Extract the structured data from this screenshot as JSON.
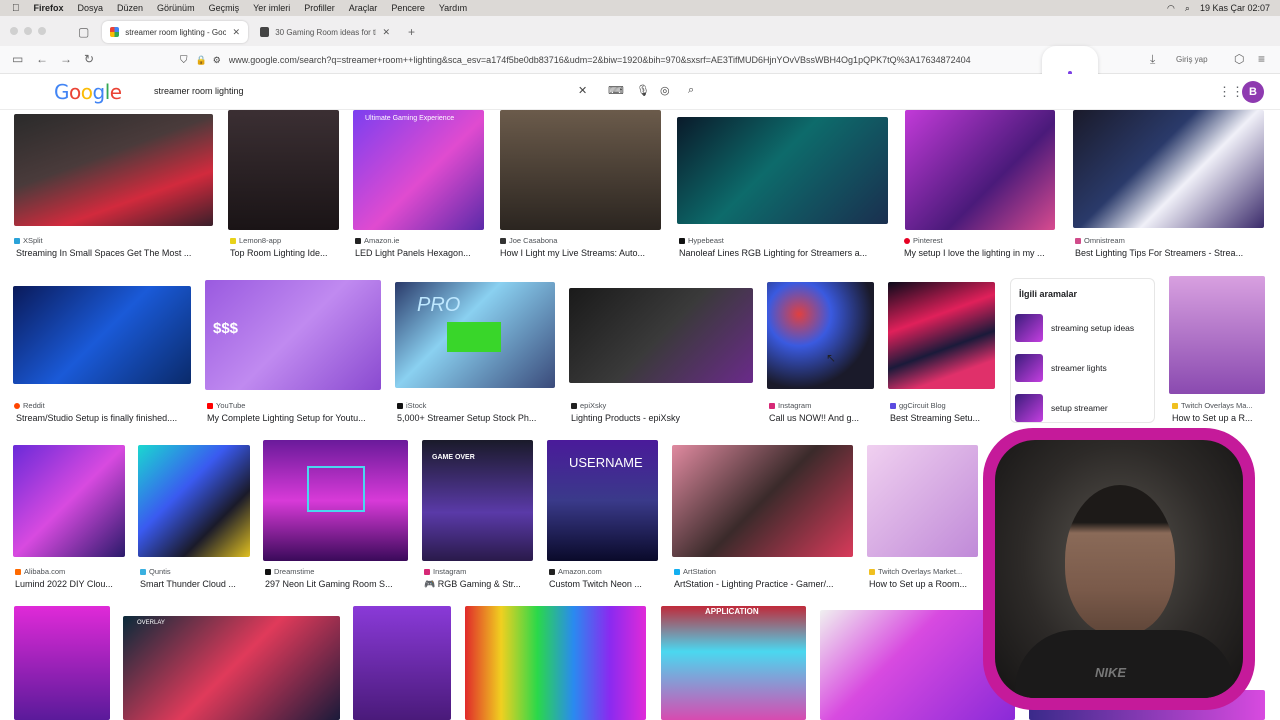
{
  "menubar": {
    "items": [
      "Firefox",
      "Dosya",
      "Düzen",
      "Görünüm",
      "Geçmiş",
      "Yer imleri",
      "Profiller",
      "Araçlar",
      "Pencere",
      "Yardım"
    ],
    "clock": "19 Kas Çar 02:07"
  },
  "tabs": [
    {
      "label": "streamer room lighting - Google",
      "active": true
    },
    {
      "label": "30 Gaming Room ideas for the B",
      "active": false
    }
  ],
  "navbar": {
    "url": "www.google.com/search?q=streamer+room++lighting&sca_esv=a174f5be0db83716&udm=2&biw=1920&bih=970&sxsrf=AE3TifMUD6HjnYOvVBssWBH4Og1pQPK7tQ%3A17634872404",
    "login": "Giriş yap"
  },
  "google": {
    "logo": "Google",
    "query": "streamer room lighting",
    "avatar_letter": "B"
  },
  "results": [
    {
      "source": "XSplit",
      "title": "Streaming In Small Spaces Get The Most ..."
    },
    {
      "source": "Lemon8-app",
      "title": "Top Room Lighting Ide..."
    },
    {
      "source": "Amazon.ie",
      "title": "LED Light Panels Hexagon..."
    },
    {
      "source": "Joe Casabona",
      "title": "How I Light my Live Streams: Auto..."
    },
    {
      "source": "Hypebeast",
      "title": "Nanoleaf Lines RGB Lighting for Streamers a..."
    },
    {
      "source": "Pinterest",
      "title": "My setup I love the lighting in my ..."
    },
    {
      "source": "Omnistream",
      "title": "Best Lighting Tips For Streamers - Strea..."
    },
    {
      "source": "Reddit",
      "title": "Stream/Studio Setup is finally finished...."
    },
    {
      "source": "YouTube",
      "title": "My Complete Lighting Setup for Youtu..."
    },
    {
      "source": "iStock",
      "title": "5,000+ Streamer Setup Stock Ph..."
    },
    {
      "source": "epiXsky",
      "title": "Lighting Products - epiXsky"
    },
    {
      "source": "Instagram",
      "title": "Call us NOW!! And g..."
    },
    {
      "source": "ggCircuit Blog",
      "title": "Best Streaming Setu..."
    },
    {
      "source": "Twitch Overlays Ma...",
      "title": "How to Set up a R..."
    },
    {
      "source": "Alibaba.com",
      "title": "Lumind 2022 DIY Clou..."
    },
    {
      "source": "Quntis",
      "title": "Smart Thunder Cloud ..."
    },
    {
      "source": "Dreamstime",
      "title": "297 Neon Lit Gaming Room S..."
    },
    {
      "source": "Instagram",
      "title": "🎮 RGB Gaming & Str..."
    },
    {
      "source": "Amazon.com",
      "title": "Custom Twitch Neon ..."
    },
    {
      "source": "ArtStation",
      "title": "ArtStation - Lighting Practice - Gamer/..."
    },
    {
      "source": "Twitch Overlays Market...",
      "title": "How to Set up a Room..."
    }
  ],
  "image_text": {
    "gaming_experience": "Ultimate Gaming Experience",
    "pro": "PRO",
    "game_over": "GAME OVER",
    "username": "USERNAME",
    "application": "APPLICATION",
    "overlay": "OVERLAY"
  },
  "related": {
    "heading": "İlgili aramalar",
    "items": [
      {
        "text": "streaming setup ideas"
      },
      {
        "text": "streamer lights"
      },
      {
        "text": "setup streamer"
      }
    ]
  },
  "webcam": {
    "shirt_logo": "NIKE"
  }
}
